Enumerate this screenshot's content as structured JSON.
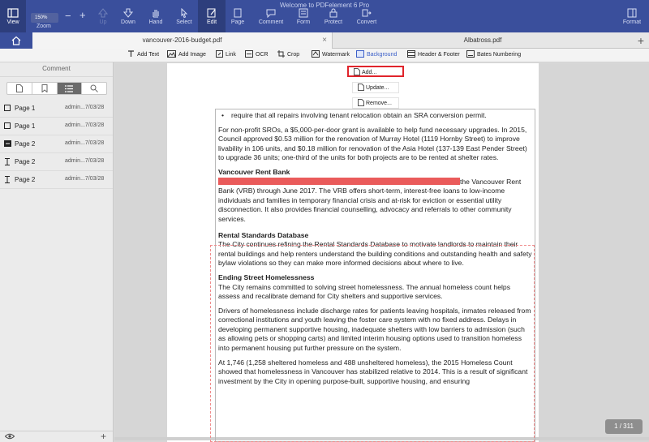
{
  "window": {
    "title": "Welcome to PDFelement 6 Pro"
  },
  "toolbar": {
    "view": "View",
    "zoom_value": "150%",
    "zoom_label": "Zoom",
    "up": "Up",
    "down": "Down",
    "hand": "Hand",
    "select": "Select",
    "edit": "Edit",
    "page": "Page",
    "comment": "Comment",
    "form": "Form",
    "protect": "Protect",
    "convert": "Convert",
    "format": "Format"
  },
  "tabs": [
    {
      "label": "vancouver-2016-budget.pdf",
      "active": true
    },
    {
      "label": "Albatross.pdf",
      "active": false
    }
  ],
  "edit_tools": [
    {
      "label": "Add Text",
      "icon": "add-text-icon"
    },
    {
      "label": "Add Image",
      "icon": "add-image-icon"
    },
    {
      "label": "Link",
      "icon": "link-icon"
    },
    {
      "label": "OCR",
      "icon": "ocr-icon"
    },
    {
      "label": "Crop",
      "icon": "crop-icon"
    },
    {
      "label": "Watermark",
      "icon": "watermark-icon"
    },
    {
      "label": "Background",
      "icon": "background-icon",
      "active": true
    },
    {
      "label": "Header & Footer",
      "icon": "header-footer-icon"
    },
    {
      "label": "Bates Numbering",
      "icon": "bates-numbering-icon"
    }
  ],
  "background_menu": [
    "Add...",
    "Update...",
    "Remove..."
  ],
  "sidebar": {
    "title": "Comment",
    "tabs": [
      "page-icon",
      "bookmark-icon",
      "list-icon",
      "search-icon"
    ],
    "items": [
      {
        "page": "Page 1",
        "meta": "admin...7/03/28",
        "icon": "note-icon"
      },
      {
        "page": "Page 1",
        "meta": "admin...7/03/28",
        "icon": "note-icon"
      },
      {
        "page": "Page 2",
        "meta": "admin...7/03/28",
        "icon": "highlight-icon"
      },
      {
        "page": "Page 2",
        "meta": "admin...7/03/28",
        "icon": "text-cursor-icon"
      },
      {
        "page": "Page 2",
        "meta": "admin...7/03/28",
        "icon": "text-cursor-icon"
      }
    ]
  },
  "doc": {
    "bullet": "require that all repairs involving tenant relocation obtain an SRA conversion permit.",
    "p1": "For non-profit SROs, a $5,000-per-door grant is available to help fund necessary upgrades. In 2015, Council approved $0.53 million for the renovation of Murray Hotel (1119 Hornby Street) to improve livability in 106 units, and $0.18 million for renovation of the Asia Hotel (137-139 East Pender Street) to upgrade 36 units; one-third of the units for both projects are to be rented at shelter rates.",
    "h1": "Vancouver Rent Bank",
    "p2_start": "the Vancouver Rent",
    "p2": "Bank (VRB) through June 2017. The VRB offers short-term, interest-free loans to low-income individuals and families in temporary financial crisis and at-risk for eviction or essential utility disconnection. It also provides financial counselling, advocacy and referrals to other community services.",
    "h2": "Rental Standards Database",
    "p3": "The City continues refining the Rental Standards Database to motivate landlords to maintain their rental buildings and help renters understand the building conditions and outstanding health and safety bylaw violations so they can make more informed decisions about where to live.",
    "h3": "Ending Street Homelessness",
    "p4": "The City remains committed to solving street homelessness. The annual homeless count helps assess and recalibrate demand for City shelters and supportive services.",
    "p5": "Drivers of homelessness include discharge rates for patients leaving hospitals, inmates released from correctional institutions and youth leaving the foster care system with no fixed address. Delays in developing permanent supportive housing, inadequate shelters with low barriers to admission (such as allowing pets or shopping carts) and limited interim housing options used to transition homeless into permanent housing put further pressure on the system.",
    "p6": "At 1,746 (1,258 sheltered homeless and 488 unsheltered homeless), the 2015 Homeless Count showed that homelessness in Vancouver has stabilized relative to 2014. This is a result of significant investment by the City in opening purpose-built, supportive housing, and ensuring"
  },
  "page_counter": "1 / 311"
}
